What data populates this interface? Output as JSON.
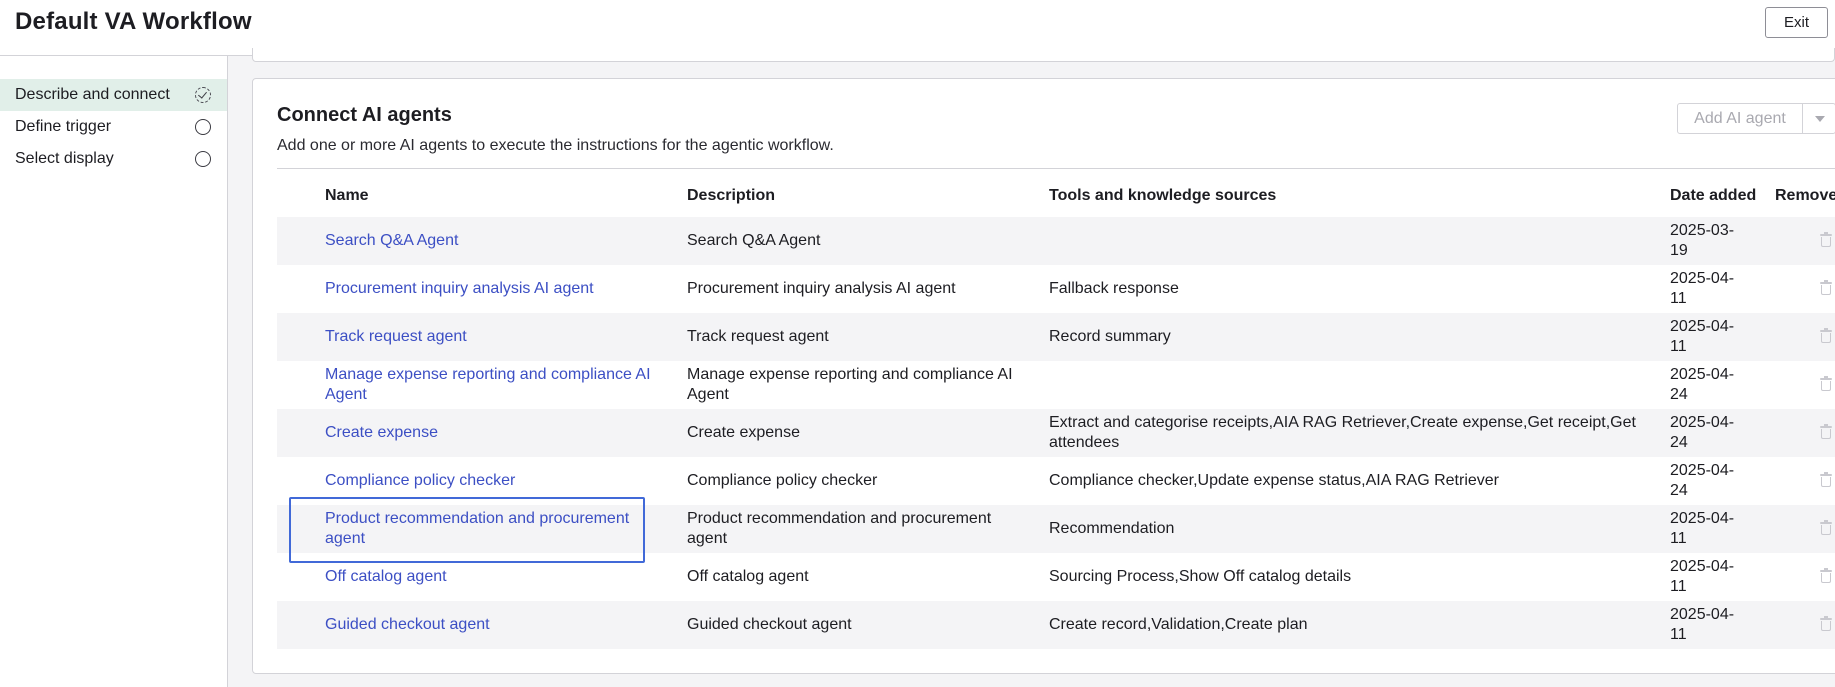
{
  "header": {
    "title": "Default VA Workflow",
    "exit_label": "Exit"
  },
  "sidebar": {
    "steps": [
      {
        "label": "Describe and connect",
        "status": "complete",
        "active": true
      },
      {
        "label": "Define trigger",
        "status": "pending",
        "active": false
      },
      {
        "label": "Select display",
        "status": "pending",
        "active": false
      }
    ]
  },
  "section": {
    "title": "Connect AI agents",
    "subtitle": "Add one or more AI agents to execute the instructions for the agentic workflow.",
    "add_button_label": "Add AI agent"
  },
  "table": {
    "columns": {
      "name": "Name",
      "description": "Description",
      "tools": "Tools and knowledge sources",
      "date": "Date added",
      "remove": "Remove"
    },
    "rows": [
      {
        "name": "Search Q&A Agent",
        "description": "Search Q&A Agent",
        "tools": "",
        "date": "2025-03-19"
      },
      {
        "name": "Procurement inquiry analysis AI agent",
        "description": "Procurement inquiry analysis AI agent",
        "tools": "Fallback response",
        "date": "2025-04-11"
      },
      {
        "name": "Track request agent",
        "description": "Track request agent",
        "tools": "Record summary",
        "date": "2025-04-11"
      },
      {
        "name": "Manage expense reporting and compliance AI Agent",
        "description": "Manage expense reporting and compliance AI Agent",
        "tools": "",
        "date": "2025-04-24"
      },
      {
        "name": "Create expense",
        "description": "Create expense",
        "tools": "Extract and categorise receipts,AIA RAG Retriever,Create expense,Get receipt,Get attendees",
        "date": "2025-04-24"
      },
      {
        "name": "Compliance policy checker",
        "description": "Compliance policy checker",
        "tools": "Compliance checker,Update expense status,AIA RAG Retriever",
        "date": "2025-04-24"
      },
      {
        "name": "Product recommendation and procurement agent",
        "description": "Product recommendation and procurement agent",
        "tools": "Recommendation",
        "date": "2025-04-11"
      },
      {
        "name": "Off catalog agent",
        "description": "Off catalog agent",
        "tools": "Sourcing Process,Show Off catalog details",
        "date": "2025-04-11"
      },
      {
        "name": "Guided checkout agent",
        "description": "Guided checkout agent",
        "tools": "Create record,Validation,Create plan",
        "date": "2025-04-11"
      }
    ]
  }
}
